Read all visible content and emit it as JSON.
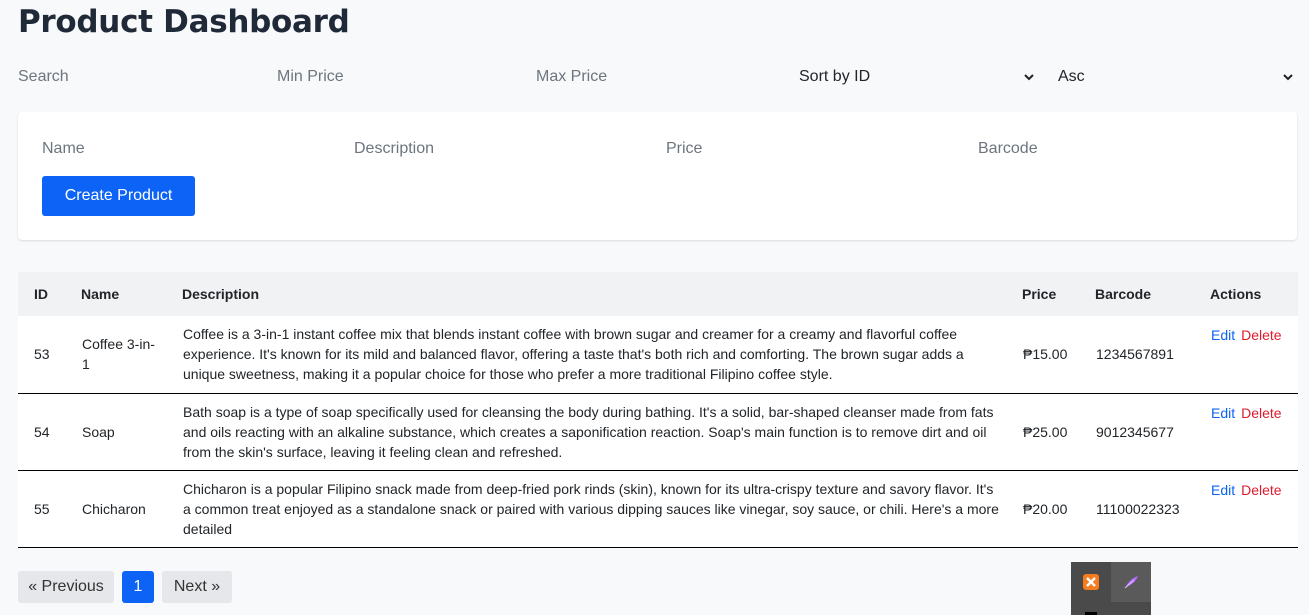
{
  "page": {
    "title": "Product Dashboard"
  },
  "filters": {
    "search_placeholder": "Search",
    "min_price_placeholder": "Min Price",
    "max_price_placeholder": "Max Price",
    "sort_by": "Sort by ID",
    "order": "Asc"
  },
  "form": {
    "name_placeholder": "Name",
    "description_placeholder": "Description",
    "price_placeholder": "Price",
    "barcode_placeholder": "Barcode",
    "create_label": "Create Product"
  },
  "table": {
    "headers": [
      "ID",
      "Name",
      "Description",
      "Price",
      "Barcode",
      "Actions"
    ],
    "rows": [
      {
        "id": "53",
        "name": "Coffee 3-in-1",
        "description": "Coffee is a 3-in-1 instant coffee mix that blends instant coffee with brown sugar and creamer for a creamy and flavorful coffee experience. It's known for its mild and balanced flavor, offering a taste that's both rich and comforting. The brown sugar adds a unique sweetness, making it a popular choice for those who prefer a more traditional Filipino coffee style.",
        "price": "₱15.00",
        "barcode": "1234567891",
        "edit": "Edit",
        "delete": "Delete"
      },
      {
        "id": "54",
        "name": "Soap",
        "description": "Bath soap is a type of soap specifically used for cleansing the body during bathing. It's a solid, bar-shaped cleanser made from fats and oils reacting with an alkaline substance, which creates a saponification reaction. Soap's main function is to remove dirt and oil from the skin's surface, leaving it feeling clean and refreshed.",
        "price": "₱25.00",
        "barcode": "9012345677",
        "edit": "Edit",
        "delete": "Delete"
      },
      {
        "id": "55",
        "name": "Chicharon",
        "description": "Chicharon is a popular Filipino snack made from deep-fried pork rinds (skin), known for its ultra-crispy texture and savory flavor. It's a common treat enjoyed as a standalone snack or paired with various dipping sauces like vinegar, soy sauce, or chili. Here's a more detailed",
        "price": "₱20.00",
        "barcode": "11100022323",
        "edit": "Edit",
        "delete": "Delete"
      }
    ]
  },
  "pagination": {
    "previous": "« Previous",
    "current": "1",
    "next": "Next »"
  },
  "colors": {
    "primary": "#0d63f5",
    "danger": "#dc1c2e",
    "background": "#f8f9fb"
  },
  "tray_icons": [
    "xampp-icon",
    "feather-icon"
  ]
}
